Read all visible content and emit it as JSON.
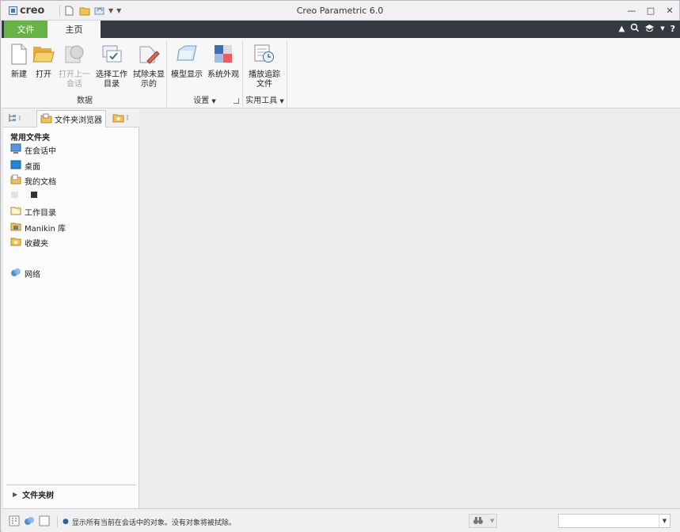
{
  "app": {
    "logo_text": "creo",
    "title": "Creo Parametric 6.0"
  },
  "window_controls": {
    "minimize": "—",
    "maximize": "□",
    "close": "✕"
  },
  "ribbon_tabs": {
    "file": "文件",
    "home": "主页"
  },
  "ribbon": {
    "data_group": {
      "label": "数据",
      "new": "新建",
      "open": "打开",
      "open_last_line1": "打开上一",
      "open_last_line2": "会话",
      "select_wd_line1": "选择工作",
      "select_wd_line2": "目录",
      "erase_line1": "拭除未显",
      "erase_line2": "示的"
    },
    "settings_group": {
      "label": "设置",
      "model_display": "模型显示",
      "system_appearance": "系统外观"
    },
    "utilities_group": {
      "label": "实用工具",
      "play_trail_line1": "播放追踪",
      "play_trail_line2": "文件"
    }
  },
  "navigator": {
    "tab_folder_browser": "文件夹浏览器",
    "heading": "常用文件夹",
    "items": [
      "在会话中",
      "桌面",
      "我的文档",
      "",
      "工作目录",
      "Manikin 库",
      "收藏夹",
      "网络"
    ],
    "footer": "文件夹树"
  },
  "status": {
    "message": "显示所有当前在会话中的对象。没有对象将被拭除。"
  },
  "colors": {
    "file_tab": "#67b346",
    "tab_bar": "#333a40",
    "accent_blue": "#4a78b5"
  }
}
